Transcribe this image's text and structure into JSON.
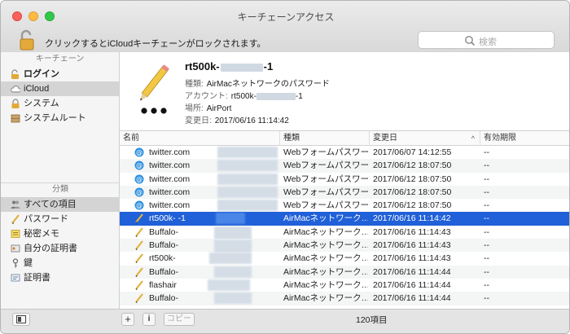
{
  "window": {
    "title": "キーチェーンアクセス"
  },
  "toolbar": {
    "lock_text": "クリックするとiCloudキーチェーンがロックされます。",
    "search_placeholder": "検索"
  },
  "sidebar": {
    "keychain_header": "キーチェーン",
    "keychains": [
      {
        "label": "ログイン",
        "icon": "lock-open-icon",
        "bold": true
      },
      {
        "label": "iCloud",
        "icon": "cloud-icon",
        "selected": true
      },
      {
        "label": "システム",
        "icon": "lock-icon"
      },
      {
        "label": "システムルート",
        "icon": "cabinet-icon"
      }
    ],
    "category_header": "分類",
    "categories": [
      {
        "label": "すべての項目",
        "icon": "people-icon",
        "selected": true
      },
      {
        "label": "パスワード",
        "icon": "pencil-icon"
      },
      {
        "label": "秘密メモ",
        "icon": "note-icon"
      },
      {
        "label": "自分の証明書",
        "icon": "my-cert-icon"
      },
      {
        "label": "鍵",
        "icon": "key-icon"
      },
      {
        "label": "証明書",
        "icon": "certificate-icon"
      }
    ]
  },
  "detail": {
    "title_prefix": "rt500k-",
    "title_suffix": "-1",
    "kind_label": "種類:",
    "kind_value": "AirMacネットワークのパスワード",
    "account_label": "アカウント:",
    "account_prefix": "rt500k-",
    "account_suffix": "-1",
    "where_label": "場所:",
    "where_value": "AirPort",
    "modified_label": "変更日:",
    "modified_value": "2017/06/16 11:14:42"
  },
  "table": {
    "headers": [
      "名前",
      "種類",
      "変更日",
      "有効期限"
    ],
    "rows": [
      {
        "name": "twitter.com",
        "kind": "Webフォームパスワード",
        "date": "2017/06/07 14:12:55",
        "expires": "--",
        "icon": "at-icon"
      },
      {
        "name": "twitter.com",
        "kind": "Webフォームパスワード",
        "date": "2017/06/12 18:07:50",
        "expires": "--",
        "icon": "at-icon"
      },
      {
        "name": "twitter.com",
        "kind": "Webフォームパスワード",
        "date": "2017/06/12 18:07:50",
        "expires": "--",
        "icon": "at-icon"
      },
      {
        "name": "twitter.com",
        "kind": "Webフォームパスワード",
        "date": "2017/06/12 18:07:50",
        "expires": "--",
        "icon": "at-icon"
      },
      {
        "name": "twitter.com",
        "kind": "Webフォームパスワード",
        "date": "2017/06/12 18:07:50",
        "expires": "--",
        "icon": "at-icon"
      },
      {
        "name": "rt500k-          -1",
        "kind": "AirMacネットワーク…",
        "date": "2017/06/16 11:14:42",
        "expires": "--",
        "icon": "pencil-icon",
        "selected": true
      },
      {
        "name": "Buffalo-",
        "kind": "AirMacネットワーク…",
        "date": "2017/06/16 11:14:43",
        "expires": "--",
        "icon": "pencil-icon"
      },
      {
        "name": "Buffalo-",
        "kind": "AirMacネットワーク…",
        "date": "2017/06/16 11:14:43",
        "expires": "--",
        "icon": "pencil-icon"
      },
      {
        "name": "rt500k-",
        "kind": "AirMacネットワーク…",
        "date": "2017/06/16 11:14:43",
        "expires": "--",
        "icon": "pencil-icon"
      },
      {
        "name": "Buffalo-",
        "kind": "AirMacネットワーク…",
        "date": "2017/06/16 11:14:44",
        "expires": "--",
        "icon": "pencil-icon"
      },
      {
        "name": "flashair",
        "kind": "AirMacネットワーク…",
        "date": "2017/06/16 11:14:44",
        "expires": "--",
        "icon": "pencil-icon"
      },
      {
        "name": "Buffalo-",
        "kind": "AirMacネットワーク…",
        "date": "2017/06/16 11:14:44",
        "expires": "--",
        "icon": "pencil-icon"
      }
    ]
  },
  "bottom": {
    "add_label": "+",
    "info_label": "i",
    "copy_label": "コピー",
    "count": "120項目"
  }
}
